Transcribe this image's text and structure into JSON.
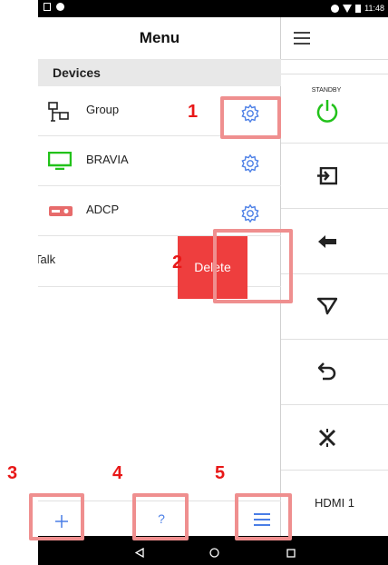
{
  "status_bar": {
    "time": "11:48"
  },
  "drawer": {
    "title": "Menu",
    "section_label": "Devices",
    "devices": [
      {
        "label": "Group",
        "icon": "network-icon"
      },
      {
        "label": "BRAVIA",
        "icon": "tv-icon"
      },
      {
        "label": "ADCP",
        "icon": "projector-icon"
      },
      {
        "label": "Talk",
        "icon": "talk-icon"
      }
    ],
    "delete_label": "Delete"
  },
  "right_panel": {
    "menu_icon": "hamburger-icon",
    "standby_label": "STANDBY",
    "buttons": [
      "input-icon",
      "back-arrow-icon",
      "send-icon",
      "return-icon",
      "mute-icon"
    ],
    "input_label": "HDMI 1"
  },
  "bottom_bar": {
    "add_icon": "plus-icon",
    "help_label": "?",
    "menu_icon": "hamburger-icon"
  },
  "annotations": [
    "1",
    "2",
    "3",
    "4",
    "5"
  ],
  "colors": {
    "accent": "#4a7ee6",
    "highlight": "#ef8f8f",
    "annotation_red": "#e81818",
    "standby_green": "#22c21a",
    "delete_red": "#ee3e3e"
  }
}
